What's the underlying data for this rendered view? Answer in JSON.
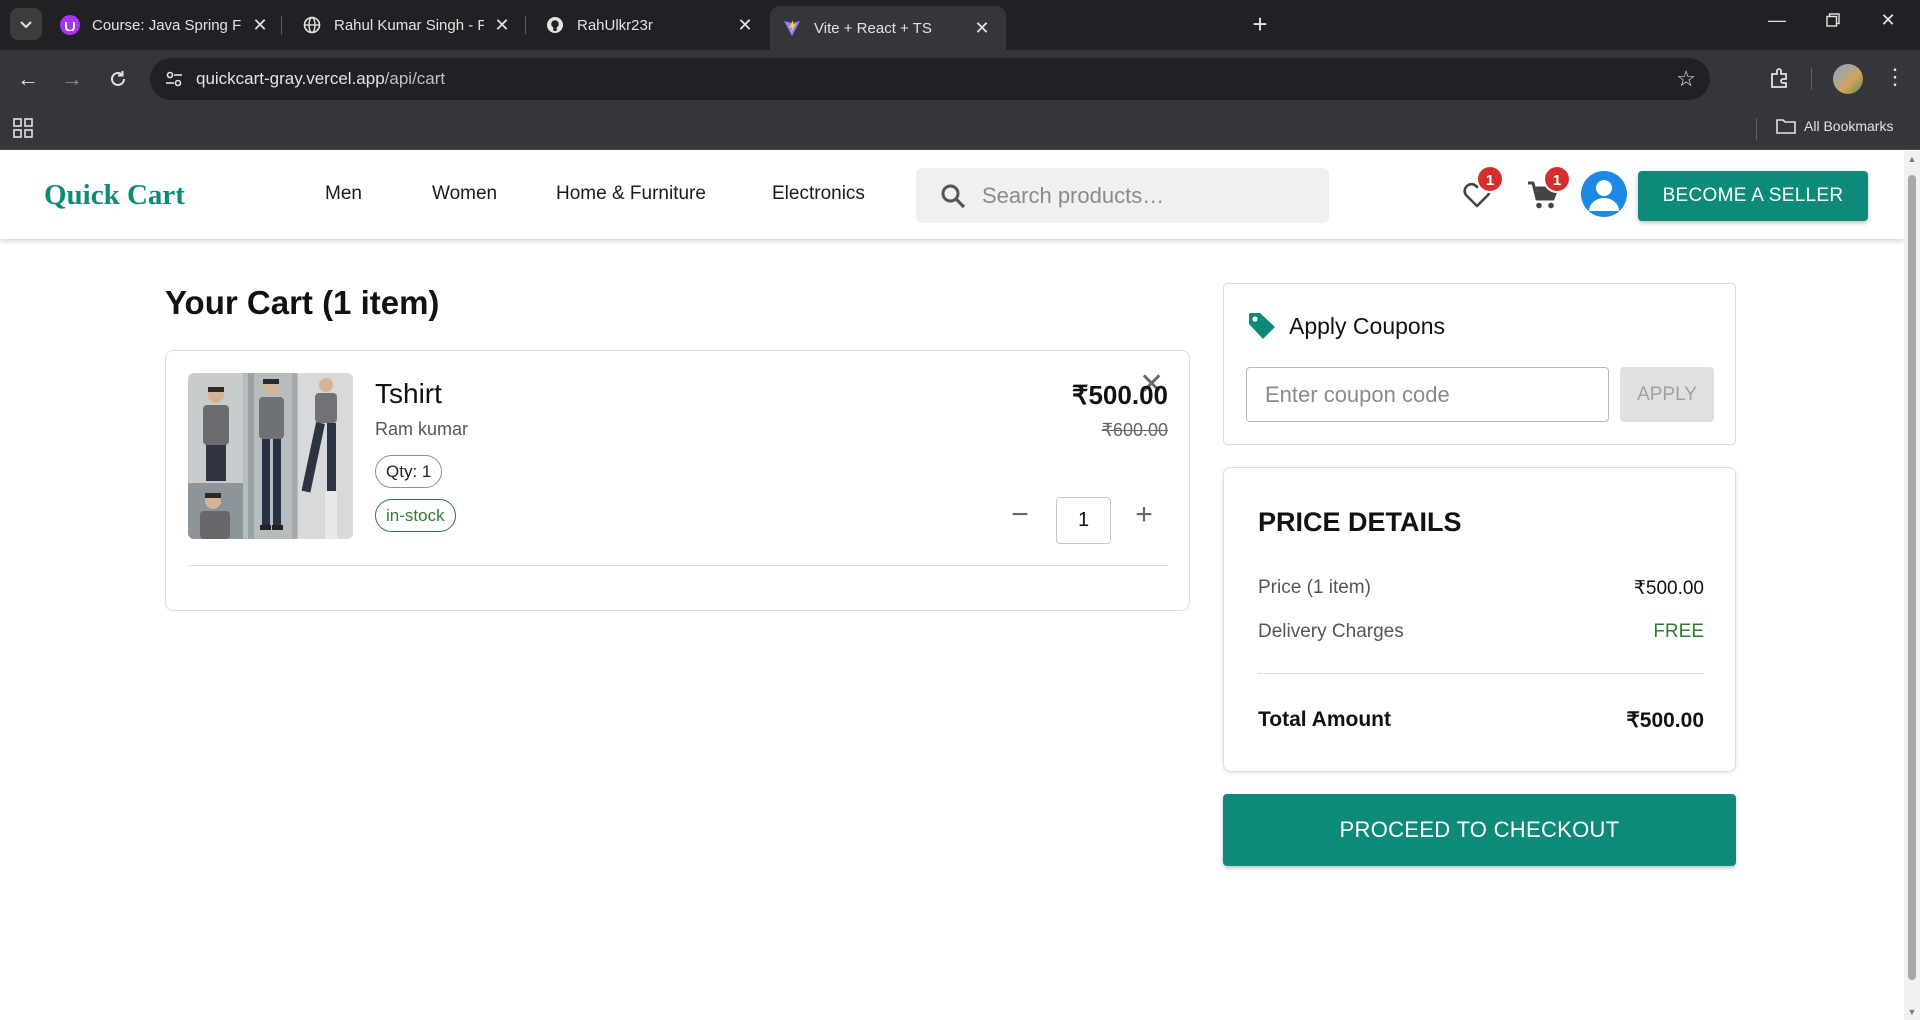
{
  "browser": {
    "tabs": [
      {
        "title": "Course: Java Spring Framework",
        "icon": "udemy-icon",
        "color": "#a435f0"
      },
      {
        "title": "Rahul Kumar Singh - Personal P",
        "icon": "globe-icon"
      },
      {
        "title": "RahUlkr23r",
        "icon": "github-icon"
      },
      {
        "title": "Vite + React + TS",
        "icon": "vite-icon",
        "active": true
      }
    ],
    "url_host": "quickcart-gray.vercel.app",
    "url_path": "/api/cart",
    "bookmarks_label": "All Bookmarks"
  },
  "header": {
    "logo": "Quick Cart",
    "nav": [
      "Men",
      "Women",
      "Home & Furniture",
      "Electronics"
    ],
    "search_placeholder": "Search products…",
    "wishlist_count": "1",
    "cart_count": "1",
    "seller_button": "BECOME A SELLER",
    "brand_color": "#0e8b78"
  },
  "cart": {
    "title": "Your Cart (1 item)",
    "items": [
      {
        "name": "Tshirt",
        "seller": "Ram kumar",
        "qty_chip": "Qty: 1",
        "stock": "in-stock",
        "price": "₹500.00",
        "original_price": "₹600.00",
        "quantity": "1",
        "remove_icon": "close-icon"
      }
    ]
  },
  "coupons": {
    "title": "Apply Coupons",
    "placeholder": "Enter coupon code",
    "apply_label": "APPLY"
  },
  "price_details": {
    "title": "PRICE DETAILS",
    "rows": [
      {
        "label": "Price (1 item)",
        "value": "₹500.00"
      },
      {
        "label": "Delivery Charges",
        "value": "FREE",
        "value_color": "#2e7d32"
      }
    ],
    "total_label": "Total Amount",
    "total_value": "₹500.00"
  },
  "checkout_label": "PROCEED TO CHECKOUT"
}
